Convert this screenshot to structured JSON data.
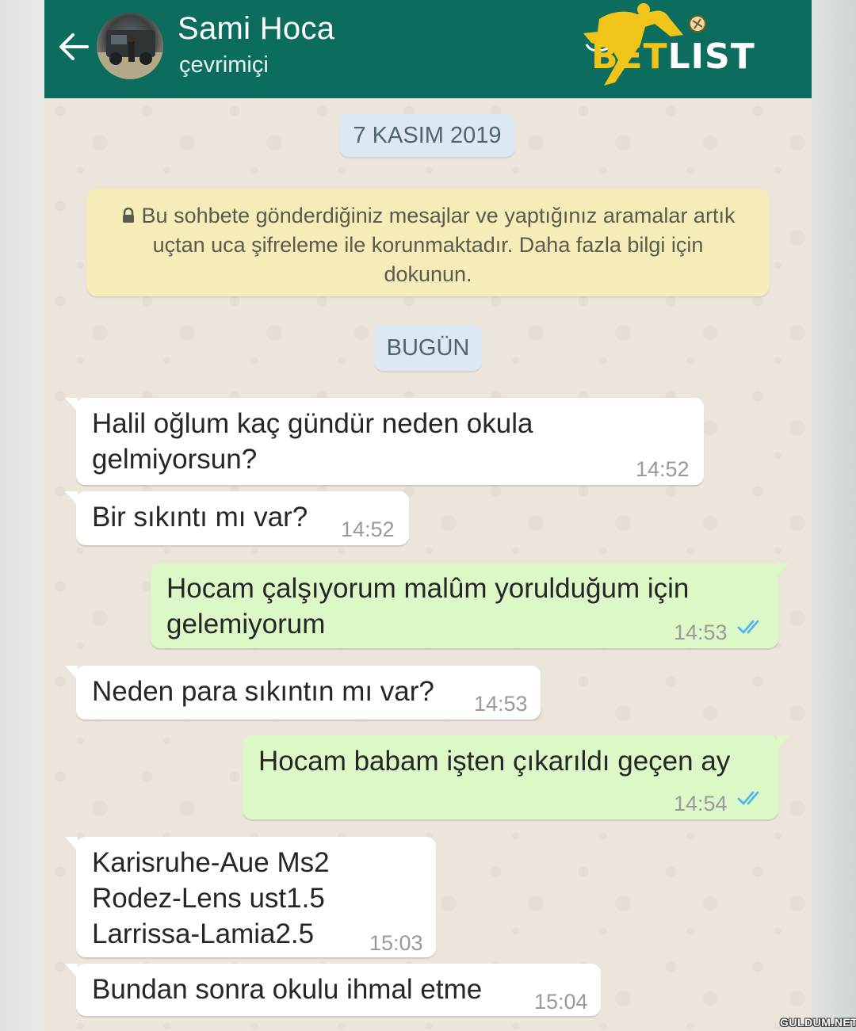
{
  "header": {
    "contact_name": "Sami Hoca",
    "status": "çevrimiçi",
    "logo_text_a": "BET",
    "logo_text_b": "LIST"
  },
  "chat": {
    "date_first": "7 KASIM 2019",
    "encryption_notice": "Bu sohbete gönderdiğiniz mesajlar ve yaptığınız aramalar artık uçtan uca şifreleme ile korunmaktadır. Daha fazla bilgi için dokunun.",
    "date_today": "BUGÜN",
    "messages": [
      {
        "direction": "in",
        "text": "Halil oğlum kaç gündür neden okula\ngelmiyorsun?",
        "time": "14:52"
      },
      {
        "direction": "in",
        "text": "Bir sıkıntı mı var?",
        "time": "14:52"
      },
      {
        "direction": "out",
        "text": "Hocam çalşıyorum malûm yorulduğum için\ngelemiyorum",
        "time": "14:53",
        "status": "read"
      },
      {
        "direction": "in",
        "text": "Neden para sıkıntın mı var?",
        "time": "14:53"
      },
      {
        "direction": "out",
        "text": "Hocam babam işten çıkarıldı geçen ay",
        "time": "14:54",
        "status": "read"
      },
      {
        "direction": "in",
        "text": "Karisruhe-Aue Ms2\nRodez-Lens ust1.5\nLarrissa-Lamia2.5",
        "time": "15:03"
      },
      {
        "direction": "in",
        "text": "Bundan sonra okulu ihmal etme",
        "time": "15:04"
      }
    ]
  },
  "watermark": "GULDUM.NET",
  "colors": {
    "header": "#0c6d5e",
    "incoming_bubble": "#ffffff",
    "outgoing_bubble": "#dcf8c7",
    "read_ticks": "#4fb6ec",
    "notice_bg": "#f6ecb8",
    "date_chip_bg": "#dde9f2",
    "logo_gold": "#f0c419"
  },
  "icons": [
    "back-arrow-icon",
    "lock-icon",
    "double-check-icon",
    "soccer-player-logo-icon"
  ]
}
